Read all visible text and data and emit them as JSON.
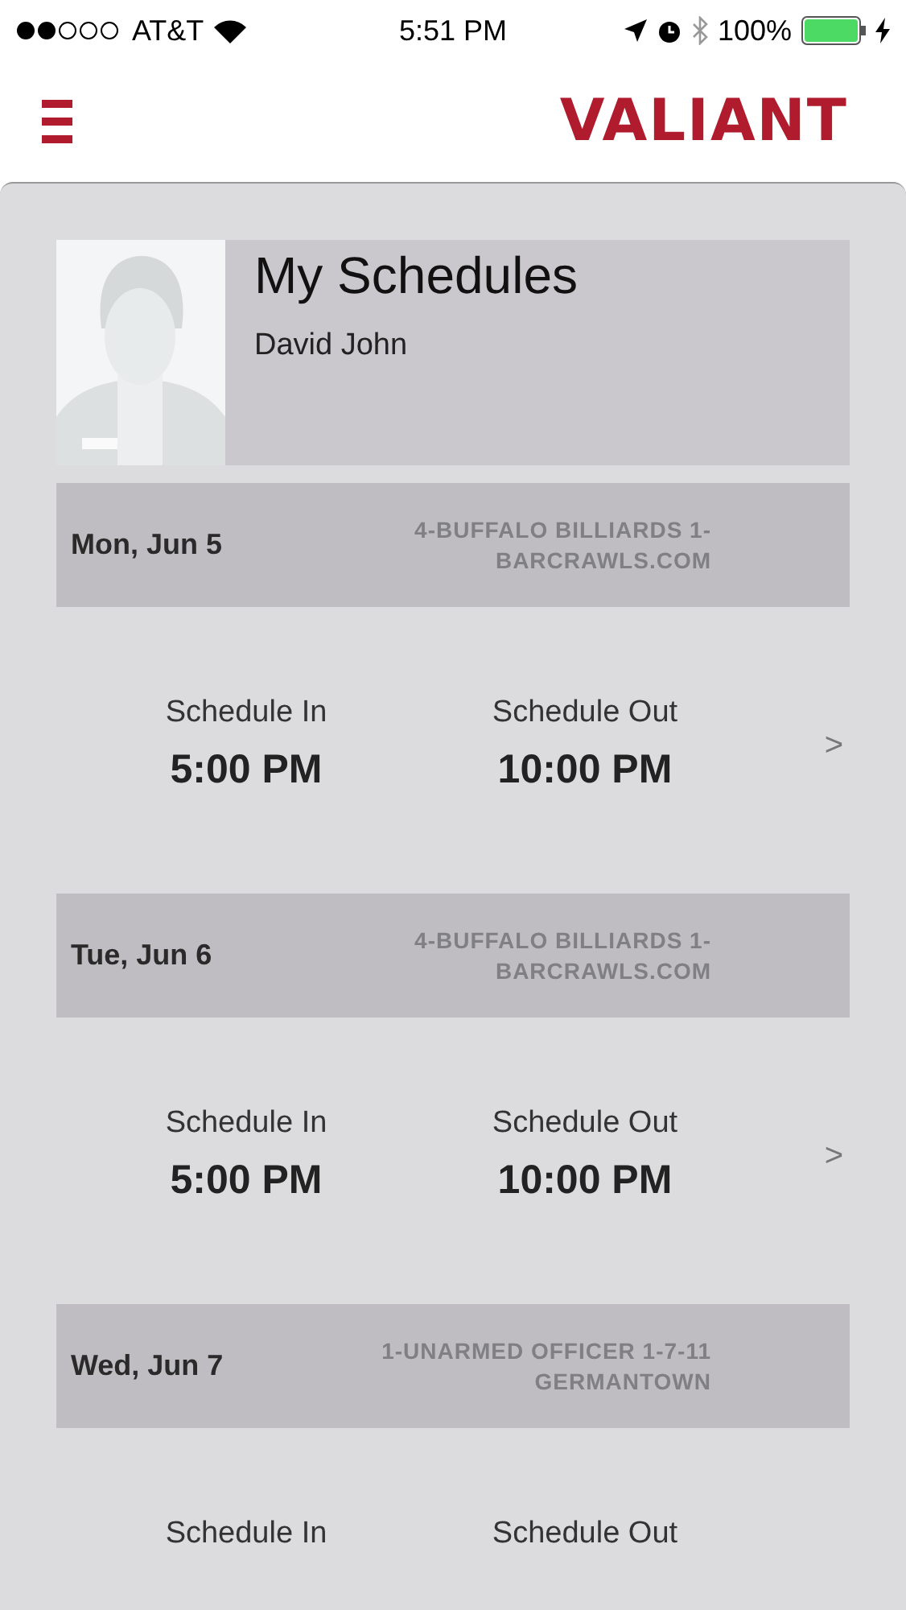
{
  "status_bar": {
    "carrier": "AT&T",
    "time": "5:51 PM",
    "battery": "100%"
  },
  "header": {
    "logo": "VALIANT"
  },
  "profile": {
    "title": "My Schedules",
    "name": "David John"
  },
  "schedules": [
    {
      "date": "Mon, Jun 5",
      "site": "4-BUFFALO BILLIARDS 1-\nBARCRAWLS.COM",
      "in_label": "Schedule In",
      "in_time": "5:00 PM",
      "out_label": "Schedule Out",
      "out_time": "10:00 PM",
      "chevron": ">"
    },
    {
      "date": "Tue, Jun 6",
      "site": "4-BUFFALO BILLIARDS 1-\nBARCRAWLS.COM",
      "in_label": "Schedule In",
      "in_time": "5:00 PM",
      "out_label": "Schedule Out",
      "out_time": "10:00 PM",
      "chevron": ">"
    },
    {
      "date": "Wed, Jun 7",
      "site": "1-UNARMED OFFICER 1-7-11\nGERMANTOWN",
      "in_label": "Schedule In",
      "out_label": "Schedule Out"
    }
  ]
}
